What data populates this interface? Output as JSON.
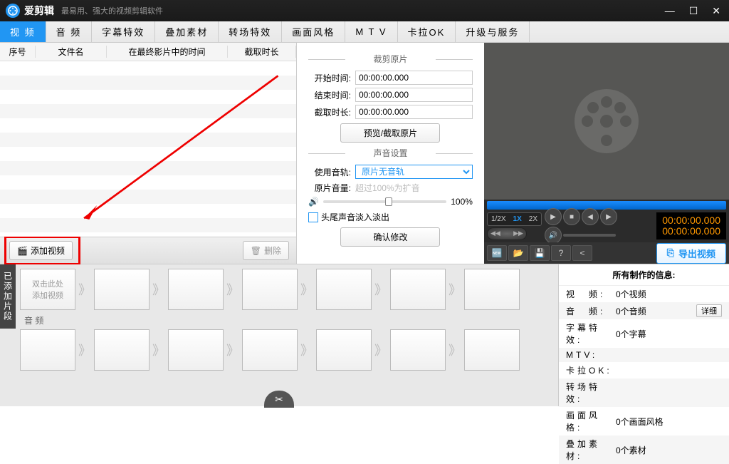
{
  "titlebar": {
    "app_name": "爱剪辑",
    "slogan": "最易用、强大的视频剪辑软件"
  },
  "tabs": [
    "视 频",
    "音 频",
    "字幕特效",
    "叠加素材",
    "转场特效",
    "画面风格",
    "M T V",
    "卡拉OK",
    "升级与服务"
  ],
  "list_header": {
    "col1": "序号",
    "col2": "文件名",
    "col3": "在最终影片中的时间",
    "col4": "截取时长"
  },
  "list_toolbar": {
    "add": "添加视频",
    "delete": "删除"
  },
  "crop": {
    "title": "裁剪原片",
    "start_label": "开始时间:",
    "start_value": "00:00:00.000",
    "end_label": "结束时间:",
    "end_value": "00:00:00.000",
    "dur_label": "截取时长:",
    "dur_value": "00:00:00.000",
    "preview_btn": "预览/截取原片"
  },
  "sound": {
    "title": "声音设置",
    "track_label": "使用音轨:",
    "track_value": "原片无音轨",
    "vol_label": "原片音量:",
    "vol_hint": "超过100%为扩音",
    "vol_value": "100%",
    "fade_label": "头尾声音淡入淡出",
    "confirm_btn": "确认修改"
  },
  "speed": {
    "half": "1/2X",
    "one": "1X",
    "two": "2X"
  },
  "timecode": {
    "t1": "00:00:00.000",
    "t2": "00:00:00.000"
  },
  "export_btn": "导出视频",
  "timeline": {
    "vtab": "已添加片段",
    "hint_l1": "双击此处",
    "hint_l2": "添加视频",
    "audio_label": "音 频"
  },
  "info": {
    "title": "所有制作的信息:",
    "rows": [
      {
        "k": "视　频:",
        "v": "0个视频"
      },
      {
        "k": "音　频:",
        "v": "0个音频",
        "detail": "详细"
      },
      {
        "k": "字幕特效:",
        "v": "0个字幕"
      },
      {
        "k": "MTV:",
        "v": ""
      },
      {
        "k": "卡拉OK:",
        "v": ""
      },
      {
        "k": "转场特效:",
        "v": ""
      },
      {
        "k": "画面风格:",
        "v": "0个画面风格"
      },
      {
        "k": "叠加素材:",
        "v": "0个素材"
      }
    ]
  }
}
